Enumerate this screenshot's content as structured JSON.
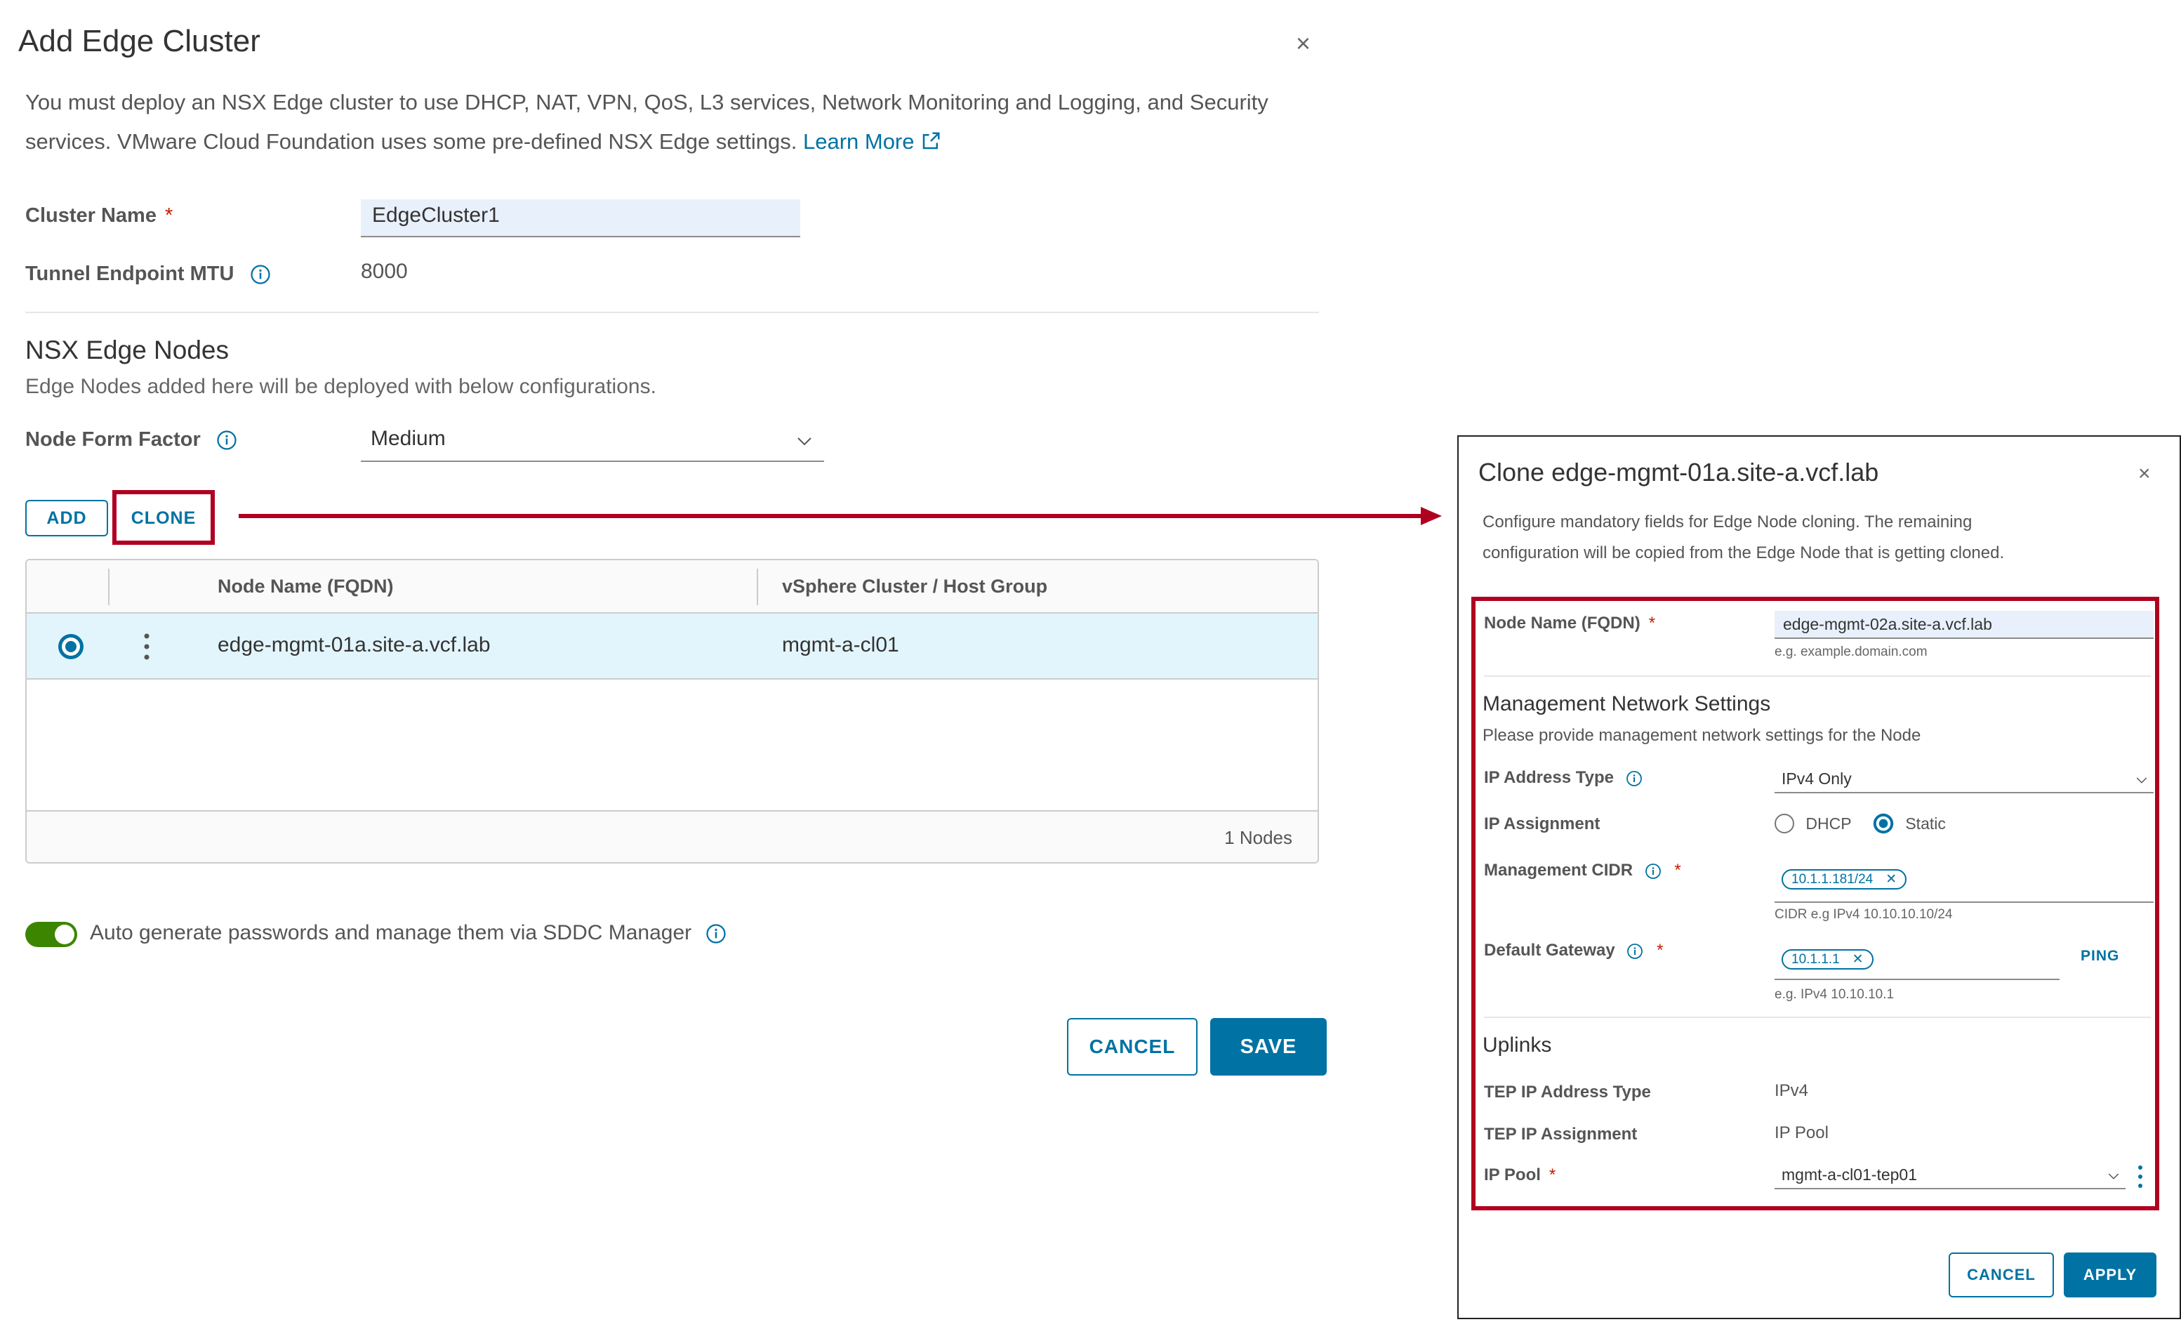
{
  "dialog": {
    "title": "Add Edge Cluster",
    "close": "×",
    "intro": "You must deploy an NSX Edge cluster to use DHCP, NAT, VPN, QoS, L3 services, Network Monitoring and Logging, and Security services. VMware Cloud Foundation uses some pre-defined NSX Edge settings.",
    "learn_more": "Learn More",
    "cluster_name_label": "Cluster Name",
    "required_mark": "*",
    "cluster_name_value": "EdgeCluster1",
    "mtu_label": "Tunnel Endpoint MTU",
    "mtu_value": "8000",
    "nodes_heading": "NSX Edge Nodes",
    "nodes_sub": "Edge Nodes added here will be deployed with below configurations.",
    "form_factor_label": "Node Form Factor",
    "form_factor_value": "Medium",
    "add_button": "ADD",
    "clone_button": "CLONE",
    "grid": {
      "columns": [
        "Node Name (FQDN)",
        "vSphere Cluster / Host Group"
      ],
      "rows": [
        {
          "node": "edge-mgmt-01a.site-a.vcf.lab",
          "cluster": "mgmt-a-cl01",
          "selected": true
        }
      ],
      "footer": "1 Nodes"
    },
    "auto_password_label": "Auto generate passwords and manage them via SDDC Manager",
    "auto_password_enabled": true,
    "cancel_button": "CANCEL",
    "save_button": "SAVE"
  },
  "clone_panel": {
    "title": "Clone edge-mgmt-01a.site-a.vcf.lab",
    "close": "×",
    "desc_line1": "Configure mandatory fields for Edge Node cloning. The remaining",
    "desc_line2": "configuration will be copied from the Edge Node that is getting cloned.",
    "node_name_label": "Node Name (FQDN)",
    "node_name_value": "edge-mgmt-02a.site-a.vcf.lab",
    "node_name_hint": "e.g. example.domain.com",
    "mgmt_heading": "Management Network Settings",
    "mgmt_sub": "Please provide management network settings for the Node",
    "ip_type_label": "IP Address Type",
    "ip_type_value": "IPv4 Only",
    "ip_assign_label": "IP Assignment",
    "ip_assign_options": [
      "DHCP",
      "Static"
    ],
    "ip_assign_selected": "Static",
    "cidr_label": "Management CIDR",
    "cidr_value": "10.1.1.181/24",
    "cidr_hint": "CIDR e.g IPv4 10.10.10.10/24",
    "gateway_label": "Default Gateway",
    "gateway_value": "10.1.1.1",
    "gateway_hint": "e.g. IPv4 10.10.10.1",
    "ping_button": "PING",
    "uplinks_heading": "Uplinks",
    "tep_type_label": "TEP IP Address Type",
    "tep_type_value": "IPv4",
    "tep_assign_label": "TEP IP Assignment",
    "tep_assign_value": "IP Pool",
    "ip_pool_label": "IP Pool",
    "ip_pool_value": "mgmt-a-cl01-tep01",
    "cancel_button": "CANCEL",
    "apply_button": "APPLY"
  },
  "colors": {
    "accent": "#0072a3",
    "highlight_box": "#b00020",
    "toggle_on": "#3c8500",
    "required": "#c21d00",
    "selected_row": "#e3f5fc"
  }
}
